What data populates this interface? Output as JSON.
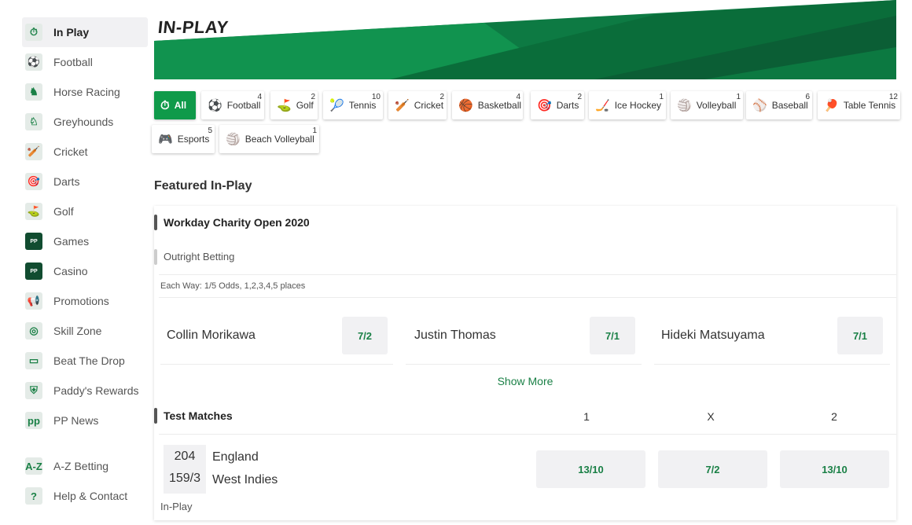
{
  "sidebar": {
    "items": [
      {
        "label": "In Play",
        "icon": "stopwatch-icon",
        "glyph": "⏱",
        "active": true
      },
      {
        "label": "Football",
        "icon": "football-icon",
        "glyph": "⚽"
      },
      {
        "label": "Horse Racing",
        "icon": "horse-icon",
        "glyph": "♞"
      },
      {
        "label": "Greyhounds",
        "icon": "greyhound-icon",
        "glyph": "♘"
      },
      {
        "label": "Cricket",
        "icon": "cricket-icon",
        "glyph": "🏏"
      },
      {
        "label": "Darts",
        "icon": "darts-icon",
        "glyph": "🎯"
      },
      {
        "label": "Golf",
        "icon": "golf-icon",
        "glyph": "⛳"
      },
      {
        "label": "Games",
        "icon": "games-logo-icon",
        "glyph": "PP",
        "dark": true
      },
      {
        "label": "Casino",
        "icon": "casino-logo-icon",
        "glyph": "PP",
        "dark": true
      },
      {
        "label": "Promotions",
        "icon": "megaphone-icon",
        "glyph": "📢"
      },
      {
        "label": "Skill Zone",
        "icon": "target-icon",
        "glyph": "◎"
      },
      {
        "label": "Beat The Drop",
        "icon": "ticket-icon",
        "glyph": "▭"
      },
      {
        "label": "Paddy's Rewards",
        "icon": "shield-icon",
        "glyph": "⛨"
      },
      {
        "label": "PP News",
        "icon": "news-icon",
        "glyph": "pp"
      }
    ],
    "bottom_items": [
      {
        "label": "A-Z Betting",
        "icon": "az-icon",
        "glyph": "A-Z"
      },
      {
        "label": "Help & Contact",
        "icon": "chat-help-icon",
        "glyph": "?"
      }
    ]
  },
  "banner": {
    "title": "IN-PLAY"
  },
  "chips": [
    {
      "label": "All",
      "count": "",
      "icon": "stopwatch-icon",
      "glyph": "⏱",
      "active": true
    },
    {
      "label": "Football",
      "count": "4",
      "icon": "football-icon",
      "glyph": "⚽"
    },
    {
      "label": "Golf",
      "count": "2",
      "icon": "golf-icon",
      "glyph": "⛳"
    },
    {
      "label": "Tennis",
      "count": "10",
      "icon": "tennis-icon",
      "glyph": "🎾"
    },
    {
      "label": "Cricket",
      "count": "2",
      "icon": "cricket-icon",
      "glyph": "🏏"
    },
    {
      "label": "Basketball",
      "count": "4",
      "icon": "basketball-icon",
      "glyph": "🏀"
    },
    {
      "label": "Darts",
      "count": "2",
      "icon": "darts-icon",
      "glyph": "🎯"
    },
    {
      "label": "Ice Hockey",
      "count": "1",
      "icon": "ice-hockey-icon",
      "glyph": "🏒"
    },
    {
      "label": "Volleyball",
      "count": "1",
      "icon": "volleyball-icon",
      "glyph": "🏐"
    },
    {
      "label": "Baseball",
      "count": "6",
      "icon": "baseball-icon",
      "glyph": "⚾"
    },
    {
      "label": "Table Tennis",
      "count": "12",
      "icon": "table-tennis-icon",
      "glyph": "🏓"
    },
    {
      "label": "Esports",
      "count": "5",
      "icon": "gamepad-icon",
      "glyph": "🎮"
    },
    {
      "label": "Beach Volleyball",
      "count": "1",
      "icon": "beach-volleyball-icon",
      "glyph": "🏐"
    }
  ],
  "featured": {
    "title": "Featured In-Play",
    "event1": {
      "name": "Workday Charity Open 2020",
      "market": "Outright Betting",
      "each_way": "Each Way: 1/5 Odds, 1,2,3,4,5 places",
      "runners": [
        {
          "name": "Collin Morikawa",
          "odds": "7/2"
        },
        {
          "name": "Justin Thomas",
          "odds": "7/1"
        },
        {
          "name": "Hideki Matsuyama",
          "odds": "7/1"
        }
      ],
      "show_more": "Show More"
    },
    "event2": {
      "name": "Test Matches",
      "col1": "1",
      "colx": "X",
      "col2": "2",
      "team1": {
        "score": "204",
        "name": "England"
      },
      "team2": {
        "score": "159/3",
        "name": "West Indies"
      },
      "odds": {
        "home": "13/10",
        "draw": "7/2",
        "away": "13/10"
      },
      "status": "In-Play"
    }
  },
  "colors": {
    "accent": "#0f9a4a",
    "banner_dark": "#0b5e35",
    "text": "#333333"
  }
}
